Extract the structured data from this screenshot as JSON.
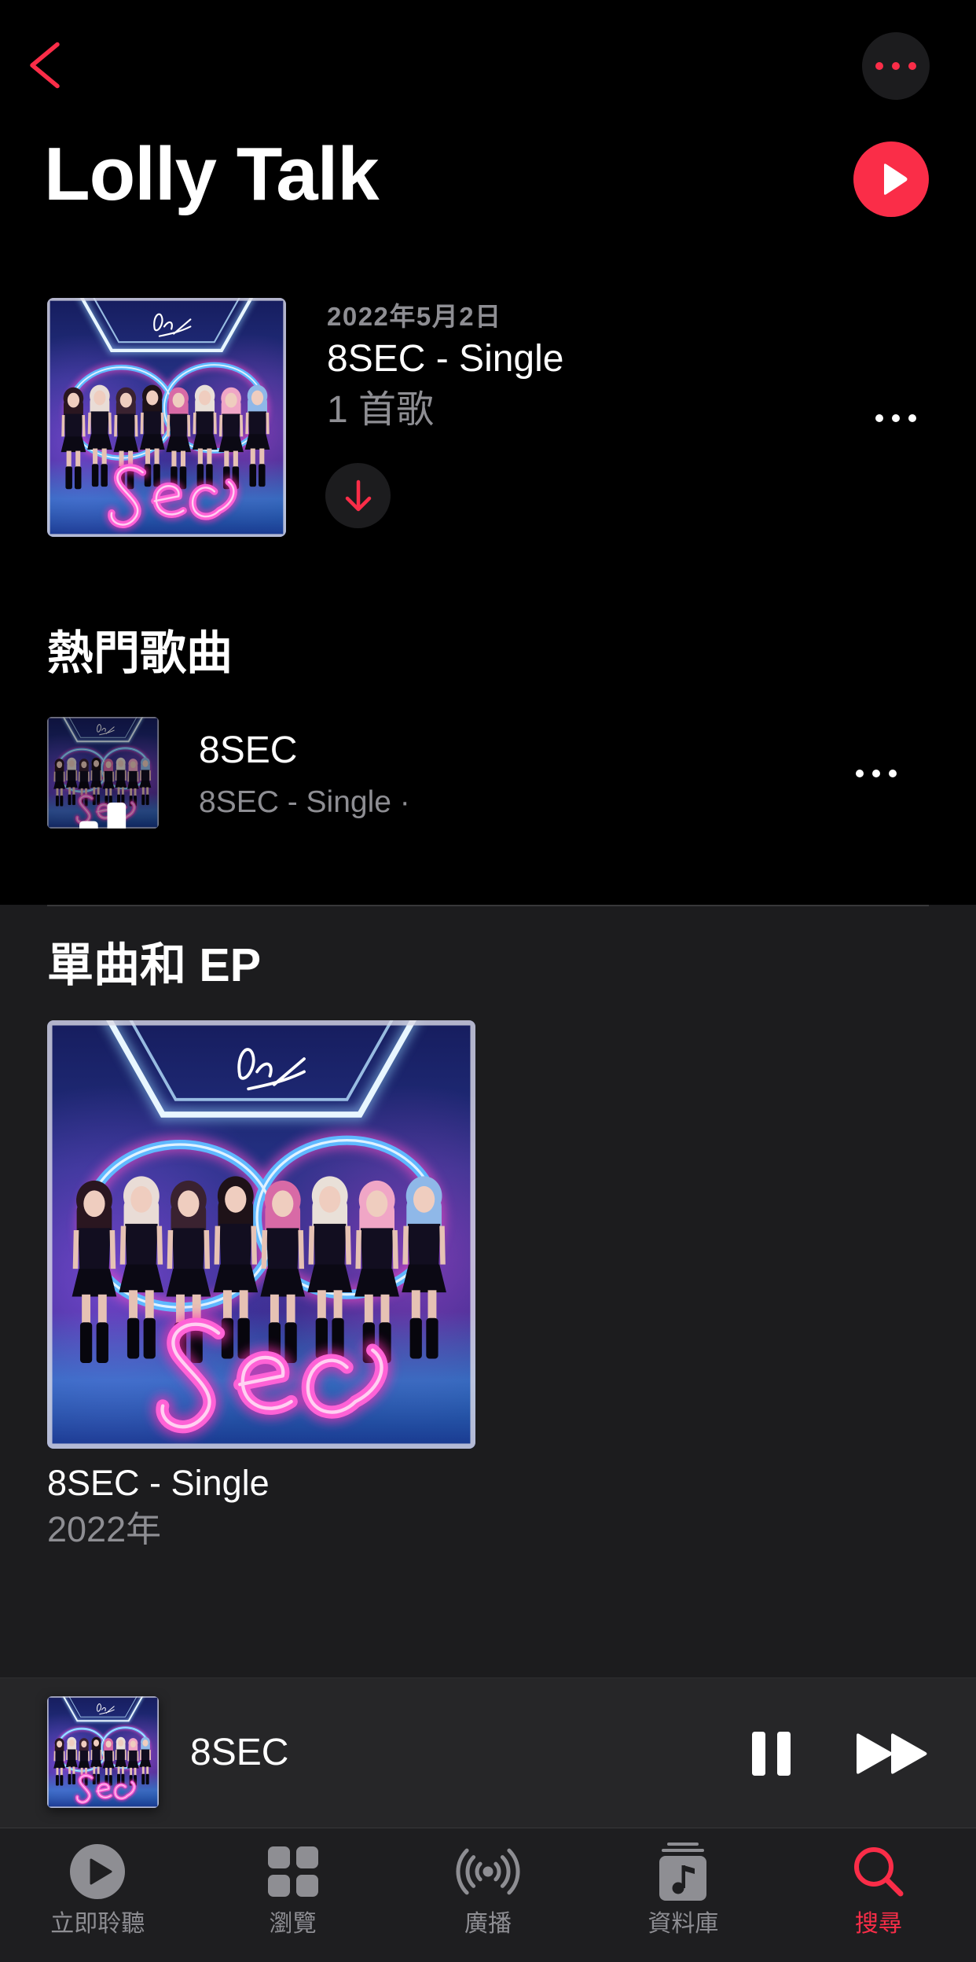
{
  "colors": {
    "accent": "#fa2d48",
    "page_background": "#000000",
    "section_background": "#1c1c1e",
    "secondary_text": "#8e8e93",
    "mini_player_background": "#262628",
    "tab_bar_background": "#1e1e20"
  },
  "header": {
    "back_icon": "chevron-left-icon",
    "more_icon": "ellipsis-icon",
    "artist_name": "Lolly Talk",
    "play_icon": "play-icon"
  },
  "latest_release": {
    "date": "2022年5月2日",
    "title": "8SEC - Single",
    "track_count": "1 首歌",
    "download_icon": "arrow-down-icon",
    "more_icon": "ellipsis-icon"
  },
  "top_songs": {
    "heading": "熱門歌曲",
    "items": [
      {
        "title": "8SEC",
        "subtitle": "8SEC - Single ·",
        "now_playing": true,
        "now_playing_icon": "equalizer-icon",
        "more_icon": "ellipsis-icon"
      }
    ]
  },
  "singles_and_eps": {
    "heading": "單曲和 EP",
    "items": [
      {
        "title": "8SEC - Single",
        "year": "2022年"
      }
    ]
  },
  "mini_player": {
    "title": "8SEC",
    "pause_icon": "pause-icon",
    "forward_icon": "forward-icon"
  },
  "tab_bar": {
    "tabs": [
      {
        "label": "立即聆聽",
        "icon": "play-circle-icon",
        "active": false
      },
      {
        "label": "瀏覽",
        "icon": "grid-icon",
        "active": false
      },
      {
        "label": "廣播",
        "icon": "radio-waves-icon",
        "active": false
      },
      {
        "label": "資料庫",
        "icon": "library-icon",
        "active": false
      },
      {
        "label": "搜尋",
        "icon": "search-icon",
        "active": true
      }
    ]
  }
}
